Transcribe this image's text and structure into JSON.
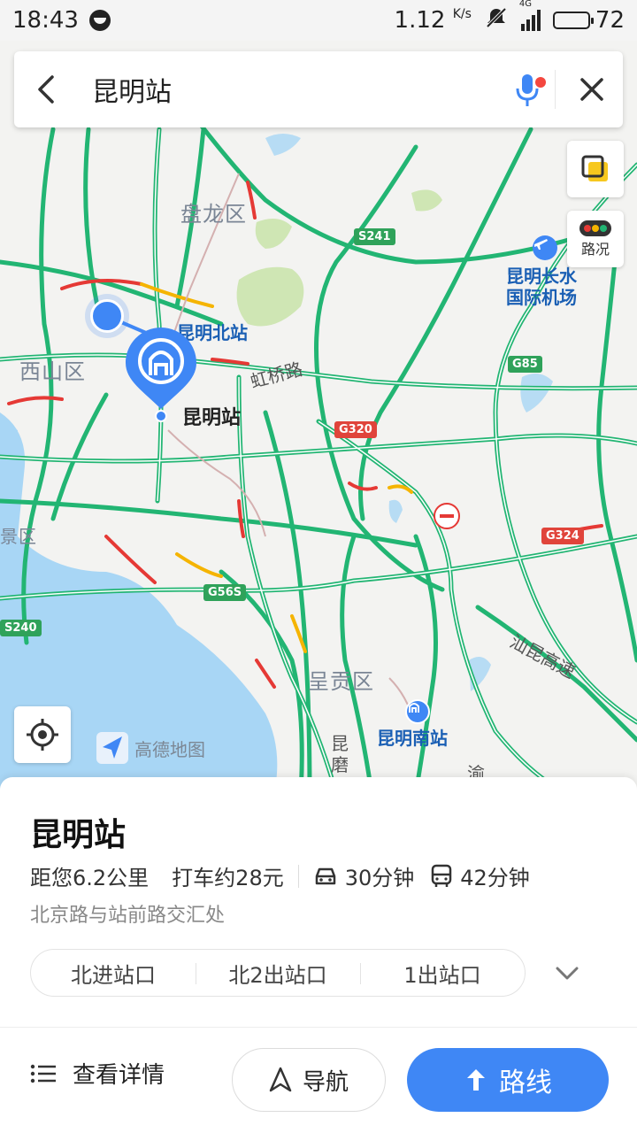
{
  "status_bar": {
    "time": "18:43",
    "network_speed": "1.12",
    "network_unit": "K/s",
    "network_type": "4G",
    "battery": "72",
    "battery_level": 0.72
  },
  "search": {
    "query": "昆明站"
  },
  "map": {
    "traffic_label": "路况",
    "logo_text": "高德地图",
    "districts": [
      "盘龙区",
      "西山区",
      "呈贡区",
      "景区"
    ],
    "pois": [
      "昆明北站",
      "昆明长水",
      "国际机场",
      "昆明南站"
    ],
    "station_label": "昆明站",
    "roads": [
      "虹桥路",
      "汕昆高速",
      "昆",
      "磨",
      "渝"
    ],
    "shields": [
      "S241",
      "G85",
      "G320",
      "G324",
      "G56S",
      "S240"
    ],
    "colors": {
      "highway_green": "#22b573",
      "congestion_red": "#e53935",
      "slow_yellow": "#f5b400",
      "water": "#a8d6f5",
      "park": "#cfe6b4",
      "accent_blue": "#3f87f5"
    }
  },
  "place": {
    "name": "昆明站",
    "distance": "距您6.2公里",
    "taxi_fare": "打车约28元",
    "drive_time": "30分钟",
    "bus_time": "42分钟",
    "address": "北京路与站前路交汇处",
    "entrances": [
      "北进站口",
      "北2出站口",
      "1出站口"
    ]
  },
  "actions": {
    "details": "查看详情",
    "navigate": "导航",
    "route": "路线"
  }
}
